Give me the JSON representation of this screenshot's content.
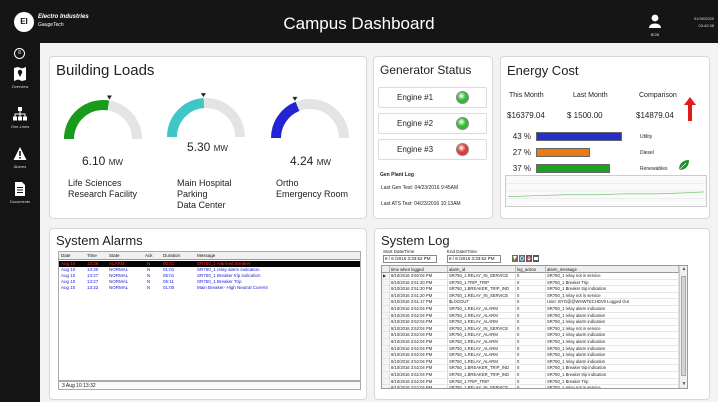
{
  "header": {
    "logo_line1": "Electro Industries",
    "logo_line2": "GaugeTech",
    "title": "Campus Dashboard",
    "user_name": "BOB",
    "date": "01/30/2020",
    "time": "03:42:38"
  },
  "sidebar": {
    "items": [
      {
        "label": "Overview",
        "icon": "map-icon"
      },
      {
        "label": "One-Lines",
        "icon": "one-line-diagram-icon"
      },
      {
        "label": "Alarms",
        "icon": "warning-icon"
      },
      {
        "label": "Documents",
        "icon": "document-icon"
      }
    ]
  },
  "building_loads": {
    "title": "Building Loads",
    "gauges": [
      {
        "value": "6.10",
        "unit": "MW",
        "level": 0.55,
        "color": "#1a9a1a",
        "label_lines": [
          "Life Sciences",
          "Research Facility"
        ]
      },
      {
        "value": "5.30",
        "unit": "MW",
        "level": 0.48,
        "color": "#3fc6c6",
        "label_lines": [
          "Main Hospital",
          "Parking",
          "Data Center"
        ]
      },
      {
        "value": "4.24",
        "unit": "MW",
        "level": 0.38,
        "color": "#2323d6",
        "label_lines": [
          "Ortho",
          "Emergency Room"
        ]
      }
    ]
  },
  "generator": {
    "title": "Generator Status",
    "engines": [
      {
        "label": "Engine #1",
        "status_color": "#34b934"
      },
      {
        "label": "Engine #2",
        "status_color": "#34b934"
      },
      {
        "label": "Engine #3",
        "status_color": "#dd3a3a"
      }
    ],
    "log_title": "Gen Plant Log",
    "log_lines": [
      "Last Gen Test: 04/23/2016 9:45AM",
      "Last ATS Test: 04/23/2016 10:13AM"
    ]
  },
  "energy_cost": {
    "title": "Energy Cost",
    "this_month_label": "This Month",
    "last_month_label": "Last Month",
    "comparison_label": "Comparison",
    "this_month_value": "$16379.04",
    "last_month_value": "$   1500.00",
    "comparison_value": "$14879.04",
    "trend_color": "#e01b1b",
    "breakdown": [
      {
        "pct": "43 %",
        "fraction": 0.43,
        "label": "Utility",
        "color": "#2430c8"
      },
      {
        "pct": "27 %",
        "fraction": 0.27,
        "label": "Diesel",
        "color": "#e77b16"
      },
      {
        "pct": "37 %",
        "fraction": 0.37,
        "label": "Renewables",
        "color": "#20a020"
      }
    ]
  },
  "system_alarms": {
    "title": "System Alarms",
    "columns": [
      "Date",
      "Time",
      "State",
      "Ack",
      "Duration",
      "Message"
    ],
    "rows": [
      {
        "date": "Aug 10",
        "time": "13:38",
        "state": "ALARM",
        "ack": "N",
        "duration": "00:01",
        "message": "SR750_1 Alarmed Breaker",
        "style": "alarm"
      },
      {
        "date": "Aug 10",
        "time": "13:30",
        "state": "NORMAL",
        "ack": "N",
        "duration": "01:01",
        "message": "SR750_1 relay alarm indication",
        "style": "normal"
      },
      {
        "date": "Aug 10",
        "time": "13:27",
        "state": "NORMAL",
        "ack": "N",
        "duration": "05:01",
        "message": "SR750_1 Breaker trip indication",
        "style": "normal"
      },
      {
        "date": "Aug 10",
        "time": "13:27",
        "state": "NORMAL",
        "ack": "N",
        "duration": "05:11",
        "message": "SR750_1 Breaker Trip",
        "style": "normal"
      },
      {
        "date": "Aug 10",
        "time": "13:32",
        "state": "NORMAL",
        "ack": "N",
        "duration": "01:00",
        "message": "Main Breaker- High Neutral Current",
        "style": "normal"
      }
    ],
    "footer": "3 Aug 10 13:32"
  },
  "system_log": {
    "title": "System Log",
    "start_label": "Start Date/Time",
    "end_label": "End Date/Time",
    "start_value": "8 / 6 /2016  3:33:52 PM",
    "end_value": "8 / 8 /2016  3:33:52 PM",
    "columns": [
      "time when logged",
      "alarm_id",
      "log_action",
      "alarm_message"
    ],
    "rows": [
      [
        "8/10/2016 3:50:04 PM",
        "SR750_1.RELAY_IN_SERVICE",
        "0",
        "SR750_1 relay not in service"
      ],
      [
        "8/10/2016 3:51:20 PM",
        "SR750_1.TRIP_TRIP",
        "0",
        "SR750_1 Breaker Trip"
      ],
      [
        "8/10/2016 3:51:20 PM",
        "SR750_1.BREAKER_TRIP_IND",
        "0",
        "SR750_1 Breaker trip indication"
      ],
      [
        "8/10/2016 3:51:20 PM",
        "SR750_1.RELAY_IN_SERVICE",
        "0",
        "SR750_1 relay not in service"
      ],
      [
        "8/10/2016 3:51:17 PM",
        "$LOGOUT",
        "0",
        "User: BYO@@WHWTECHDV0 Logged Out"
      ],
      [
        "8/10/2016 3:52:04 PM",
        "SR750_1.RELAY_ALARM",
        "0",
        "SR750_1 relay alarm indication"
      ],
      [
        "8/10/2016 3:52:04 PM",
        "SR750_1.RELAY_ALARM",
        "0",
        "SR750_1 relay alarm indication"
      ],
      [
        "8/10/2016 3:52:04 PM",
        "SR750_1.RELAY_ALARM",
        "0",
        "SR750_1 relay alarm indication"
      ],
      [
        "8/10/2016 3:52:04 PM",
        "SR750_1.RELAY_IN_SERVICE",
        "0",
        "SR750_1 relay not in service"
      ],
      [
        "8/10/2016 3:52:04 PM",
        "SR750_1.RELAY_ALARM",
        "0",
        "SR750_1 relay alarm indication"
      ],
      [
        "8/10/2016 3:52:04 PM",
        "SR750_1.RELAY_ALARM",
        "0",
        "SR750_1 relay alarm indication"
      ],
      [
        "8/10/2016 3:52:04 PM",
        "SR750_1.RELAY_ALARM",
        "0",
        "SR750_1 relay alarm indication"
      ],
      [
        "8/10/2016 3:52:04 PM",
        "SR750_1.RELAY_ALARM",
        "0",
        "SR750_1 relay alarm indication"
      ],
      [
        "8/10/2016 3:52:04 PM",
        "SR750_1.RELAY_ALARM",
        "0",
        "SR750_1 relay alarm indication"
      ],
      [
        "8/10/2016 3:52:04 PM",
        "SR750_1.BREAKER_TRIP_IND",
        "0",
        "SR750_1 Breaker trip indication"
      ],
      [
        "8/10/2016 3:52:04 PM",
        "SR750_1.BREAKER_TRIP_IND",
        "0",
        "SR750_1 Breaker trip indication"
      ],
      [
        "8/10/2016 3:52:04 PM",
        "SR750_1.TRIP_TRIP",
        "0",
        "SR750_1 Breaker Trip"
      ],
      [
        "8/10/2016 3:52:04 PM",
        "SR750_1.RELAY_IN_SERVICE",
        "0",
        "SR750_1 relay not in service"
      ]
    ]
  }
}
